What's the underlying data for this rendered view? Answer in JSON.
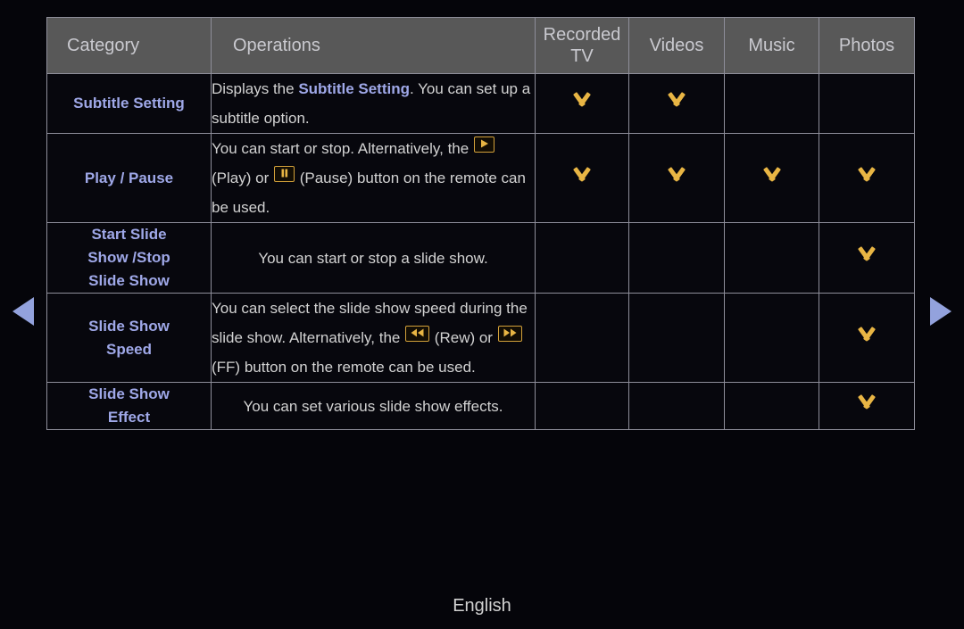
{
  "nav": {
    "prev_icon": "triangle-left-icon",
    "next_icon": "triangle-right-icon",
    "arrow_color": "#93a2dd"
  },
  "table": {
    "headers": {
      "category": "Category",
      "operations": "Operations",
      "recorded_tv_line1": "Recorded",
      "recorded_tv_line2": "TV",
      "videos": "Videos",
      "music": "Music",
      "photos": "Photos"
    },
    "rows": [
      {
        "category": "Subtitle Setting",
        "category_lines": [
          "Subtitle Setting"
        ],
        "operations_text": "Displays the Subtitle Setting. You can set up a subtitle option.",
        "operations_parts": [
          {
            "type": "text",
            "value": "Displays the "
          },
          {
            "type": "bold",
            "value": "Subtitle Setting"
          },
          {
            "type": "text",
            "value": ". You can set up a subtitle option."
          }
        ],
        "recorded_tv": true,
        "videos": true,
        "music": false,
        "photos": false
      },
      {
        "category": "Play / Pause",
        "category_lines": [
          "Play / Pause"
        ],
        "operations_text": "You can start or stop. Alternatively, the ▶ (Play) or ❚❚ (Pause) button on the remote can be used.",
        "operations_parts": [
          {
            "type": "text",
            "value": "You can start or stop. Alternatively, the "
          },
          {
            "type": "key",
            "value": "play-key-icon"
          },
          {
            "type": "text",
            "value": " (Play) or "
          },
          {
            "type": "key",
            "value": "pause-key-icon"
          },
          {
            "type": "text",
            "value": " (Pause) button on the remote can be used."
          }
        ],
        "recorded_tv": true,
        "videos": true,
        "music": true,
        "photos": true
      },
      {
        "category": "Start Slide Show /Stop Slide Show",
        "category_lines": [
          "Start Slide",
          "Show /Stop",
          "Slide Show"
        ],
        "operations_text": "You can start or stop a slide show.",
        "operations_parts": [
          {
            "type": "text",
            "value": "You can start or stop a slide show."
          }
        ],
        "recorded_tv": false,
        "videos": false,
        "music": false,
        "photos": true
      },
      {
        "category": "Slide Show Speed",
        "category_lines": [
          "Slide Show",
          "Speed"
        ],
        "operations_text": "You can select the slide show speed during the slide show. Alternatively, the ◀◀ (Rew) or ▶▶ (FF) button on the remote can be used.",
        "operations_parts": [
          {
            "type": "text",
            "value": "You can select the slide show speed during the slide show. Alternatively, the "
          },
          {
            "type": "key",
            "value": "rewind-key-icon"
          },
          {
            "type": "text",
            "value": " (Rew) or "
          },
          {
            "type": "key",
            "value": "fastforward-key-icon"
          },
          {
            "type": "text",
            "value": " (FF) button on the remote can be used."
          }
        ],
        "recorded_tv": false,
        "videos": false,
        "music": false,
        "photos": true
      },
      {
        "category": "Slide Show Effect",
        "category_lines": [
          "Slide Show",
          "Effect"
        ],
        "operations_text": "You can set various slide show effects.",
        "operations_parts": [
          {
            "type": "text",
            "value": "You can set various slide show effects."
          }
        ],
        "recorded_tv": false,
        "videos": false,
        "music": false,
        "photos": true
      }
    ]
  },
  "footer": {
    "language": "English"
  },
  "colors": {
    "background": "#05050a",
    "header_bg": "#585858",
    "cell_bg": "#07070d",
    "border": "#8e8e9a",
    "category_text": "#9fa8e8",
    "body_text": "#d2d2d2",
    "mark_gold": "#e8b544",
    "key_border": "#d3a13a",
    "arrow_blue": "#93a2dd"
  }
}
